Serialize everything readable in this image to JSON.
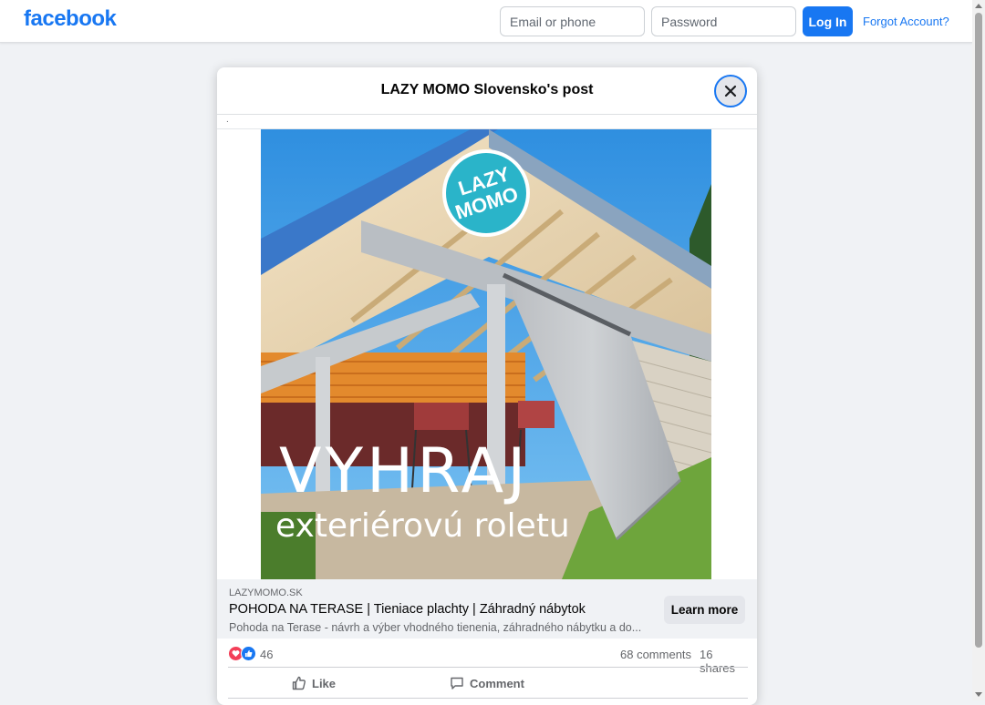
{
  "header": {
    "logo": "facebook",
    "email_placeholder": "Email or phone",
    "password_placeholder": "Password",
    "login_label": "Log In",
    "forgot_label": "Forgot Account?"
  },
  "modal": {
    "title": "LAZY MOMO Slovensko's post",
    "truncated_text": ".",
    "image": {
      "logo_line1": "LAZY",
      "logo_line2": "MOMO",
      "headline": "VYHRAJ",
      "subline": "exteriérovú roletu"
    },
    "link": {
      "domain": "LAZYMOMO.SK",
      "title": "POHODA NA TERASE | Tieniace plachty | Záhradný nábytok",
      "description": "Pohoda na Terase - návrh a výber vhodného tienenia, záhradného nábytku a do...",
      "cta": "Learn more"
    },
    "reactions": {
      "count": "46",
      "comments": "68 comments",
      "shares": "16 shares"
    },
    "actions": {
      "like": "Like",
      "comment": "Comment"
    }
  },
  "colors": {
    "brand": "#1877f2",
    "background": "#f0f2f5",
    "love": "#f33e58"
  }
}
